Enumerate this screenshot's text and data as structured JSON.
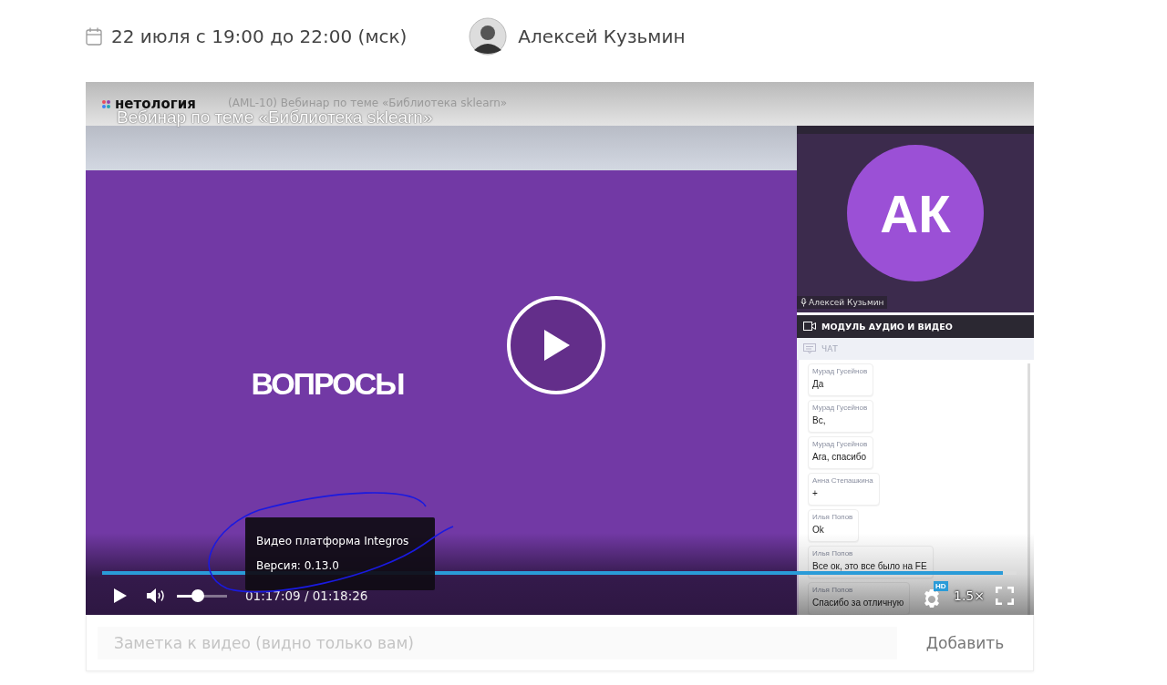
{
  "event": {
    "date": "22 июля с 19:00 до 22:00 (мск)",
    "host": "Алексей Кузьмин"
  },
  "video": {
    "brand": "нетология",
    "window_title": "(AML-10) Вебинар по теме «Библиотека sklearn»",
    "overlay_title": "Вебинар по теме «Библиотека sklearn»",
    "slide_text": "ВОПРОСЫ",
    "speaker_initials": "АК",
    "speaker_name": "Алексей Кузьмин",
    "module_label": "МОДУЛЬ АУДИО И ВИДЕО",
    "chat_label": "ЧАТ",
    "messages": [
      {
        "author": "Мурад Гусейнов",
        "text": "Да"
      },
      {
        "author": "Мурад Гусейнов",
        "text": "Вс,"
      },
      {
        "author": "Мурад Гусейнов",
        "text": "Ага, спасибо"
      },
      {
        "author": "Анна Степашкина",
        "text": "+"
      },
      {
        "author": "Илья Попов",
        "text": "Ok"
      },
      {
        "author": "Илья Попов",
        "text": "Все ок, это все было на FE"
      },
      {
        "author": "Илья Попов",
        "text": "Спасибо за отличную"
      }
    ]
  },
  "player": {
    "progress": {
      "level": 0.985
    },
    "volume": {
      "level": 0.42
    },
    "time": "01:17:09 / 01:18:26",
    "quality_badge": "HD",
    "speed": "1.5×",
    "tooltip": [
      "Видео платформа Integros",
      "Версия: 0.13.0"
    ]
  },
  "note": {
    "placeholder": "Заметка к видео (видно только вам)",
    "button": "Добавить"
  }
}
